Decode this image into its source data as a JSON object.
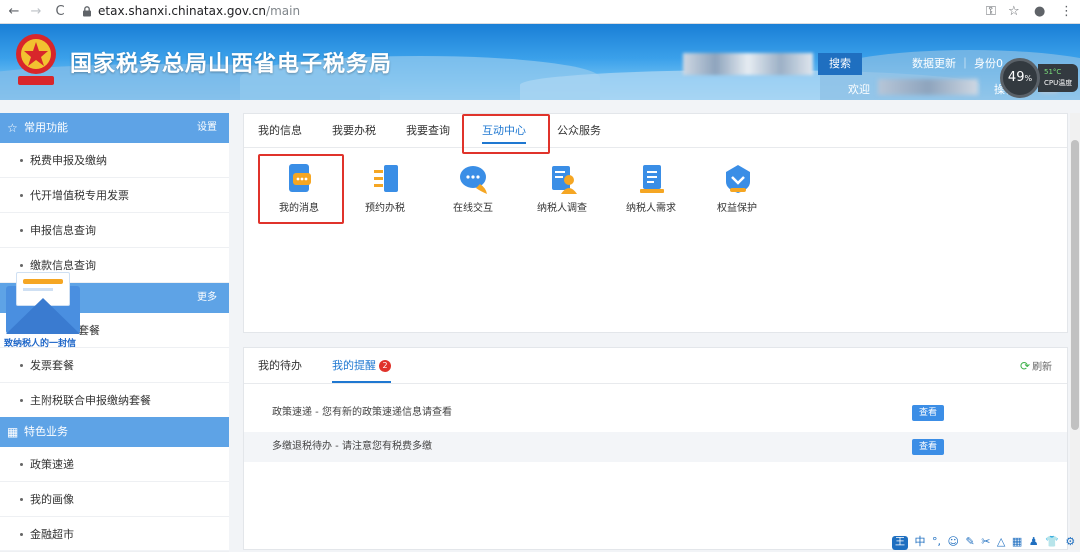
{
  "browser": {
    "url_host": "etax.shanxi.chinatax.gov.cn",
    "url_path": "/main",
    "back": "←",
    "forward": "→",
    "reload": "C"
  },
  "header": {
    "title": "国家税务总局山西省电子税务局",
    "search_button": "搜索",
    "data_update": "数据更新 ｜ 身份0",
    "welcome": "欢迎",
    "operator": "操作人:"
  },
  "cpu_widget": {
    "percent": "49",
    "percent_unit": "%",
    "temp": "51°C",
    "label": "CPU温度"
  },
  "sidebar": {
    "section1": {
      "title": "常用功能",
      "action": "设置"
    },
    "section1_items": [
      "税费申报及缴纳",
      "代开增值税专用发票",
      "申报信息查询",
      "缴款信息查询"
    ],
    "section2": {
      "title": "",
      "action": "更多"
    },
    "section2_items": [
      "套餐",
      "发票套餐",
      "主附税联合申报缴纳套餐"
    ],
    "section3": {
      "title": "特色业务"
    },
    "section3_items": [
      "政策速递",
      "我的画像",
      "金融超市"
    ]
  },
  "envelope": {
    "label": "致纳税人的一封信"
  },
  "main": {
    "tabs": [
      "我的信息",
      "我要办税",
      "我要查询",
      "互动中心",
      "公众服务"
    ],
    "active_tab": "互动中心",
    "functions": [
      "我的消息",
      "预约办税",
      "在线交互",
      "纳税人调查",
      "纳税人需求",
      "权益保护"
    ]
  },
  "reminders": {
    "tabs": [
      "我的待办",
      "我的提醒"
    ],
    "badge": "2",
    "refresh": "刷新",
    "rows": [
      {
        "text": "政策速递 - 您有新的政策速递信息请查看",
        "button": "查看"
      },
      {
        "text": "多缴退税待办 - 请注意您有税费多缴",
        "button": "查看"
      }
    ]
  },
  "ime": {
    "logo": "王",
    "items": [
      "中",
      "°,",
      "☺",
      "✎",
      "✂",
      "△",
      "▦",
      "♟",
      "👕",
      "⚙"
    ]
  },
  "colors": {
    "accent": "#1f78d1",
    "sidebar_head": "#5ea3e6",
    "highlight": "#e0332b"
  }
}
